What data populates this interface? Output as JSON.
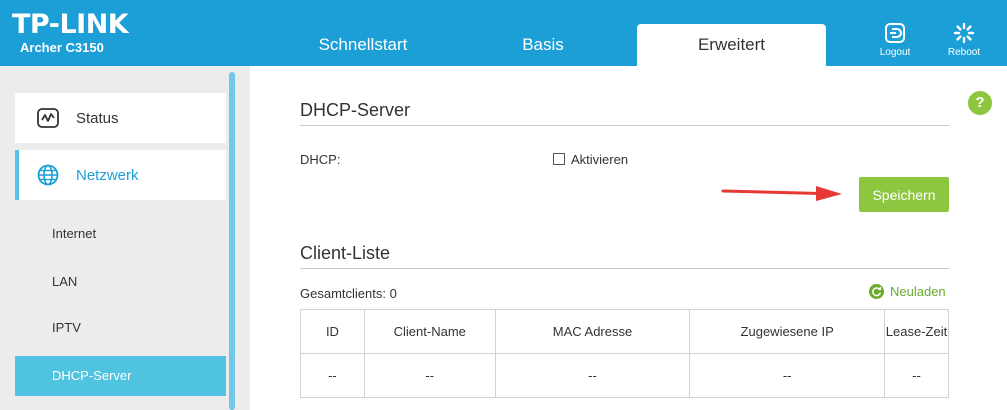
{
  "header": {
    "brand": "TP-LINK",
    "model": "Archer C3150",
    "tabs": [
      {
        "label": "Schnellstart"
      },
      {
        "label": "Basis"
      },
      {
        "label": "Erweitert"
      }
    ],
    "logout_label": "Logout",
    "reboot_label": "Reboot",
    "accent_color": "#1b9fd6"
  },
  "sidebar": {
    "items": [
      {
        "label": "Status",
        "icon": "status-chart-icon"
      },
      {
        "label": "Netzwerk",
        "icon": "globe-icon"
      }
    ],
    "subitems": [
      {
        "label": "Internet"
      },
      {
        "label": "LAN"
      },
      {
        "label": "IPTV"
      },
      {
        "label": "DHCP-Server"
      }
    ]
  },
  "main": {
    "dhcp_section_title": "DHCP-Server",
    "dhcp_label": "DHCP:",
    "activate_label": "Aktivieren",
    "activate_checked": false,
    "save_label": "Speichern",
    "client_section_title": "Client-Liste",
    "total_clients_label": "Gesamtclients:",
    "total_clients_value": "0",
    "reload_label": "Neuladen",
    "help_label": "?",
    "table": {
      "headers": [
        "ID",
        "Client-Name",
        "MAC Adresse",
        "Zugewiesene IP",
        "Lease-Zeit"
      ],
      "rows": [
        [
          "--",
          "--",
          "--",
          "--",
          "--"
        ]
      ]
    },
    "button_color": "#8dc63f"
  }
}
